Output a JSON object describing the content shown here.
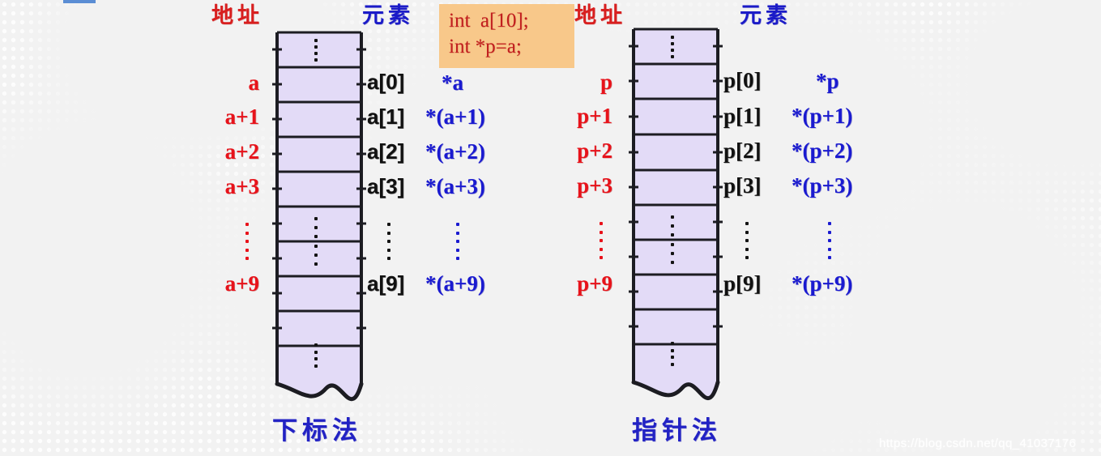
{
  "slide": {
    "background_color": "#f2f2f2",
    "accent_blue": "#1a1ad0",
    "accent_red": "#e8121a",
    "cell_fill": "#e3dbf7",
    "code_box_fill": "#f8c88a",
    "code_text_color": "#c21f1f"
  },
  "code_box": {
    "line1": "int  a[10];",
    "line2": "int *p=a;"
  },
  "left_diagram": {
    "header_address": "地址",
    "header_element": "元素",
    "caption": "下标法",
    "addresses": [
      "a",
      "a+1",
      "a+2",
      "a+3",
      "a+9"
    ],
    "address_ellipsis": "⋮",
    "elements": [
      "a[0]",
      "a[1]",
      "a[2]",
      "a[3]",
      "a[9]"
    ],
    "element_ellipsis": "⋮",
    "derefs": [
      "*a",
      "*(a+1)",
      "*(a+2)",
      "*(a+3)",
      "*(a+9)"
    ],
    "deref_ellipsis": "⋮"
  },
  "right_diagram": {
    "header_address": "地址",
    "header_element": "元素",
    "caption": "指针法",
    "addresses": [
      "p",
      "p+1",
      "p+2",
      "p+3",
      "p+9"
    ],
    "address_ellipsis": "⋮",
    "elements": [
      "p[0]",
      "p[1]",
      "p[2]",
      "p[3]",
      "p[9]"
    ],
    "element_ellipsis": "⋮",
    "derefs": [
      "*p",
      "*(p+1)",
      "*(p+2)",
      "*(p+3)",
      "*(p+9)"
    ],
    "deref_ellipsis": "⋮"
  },
  "watermark": {
    "text": "https://blog.csdn.net/qq_41037176"
  }
}
